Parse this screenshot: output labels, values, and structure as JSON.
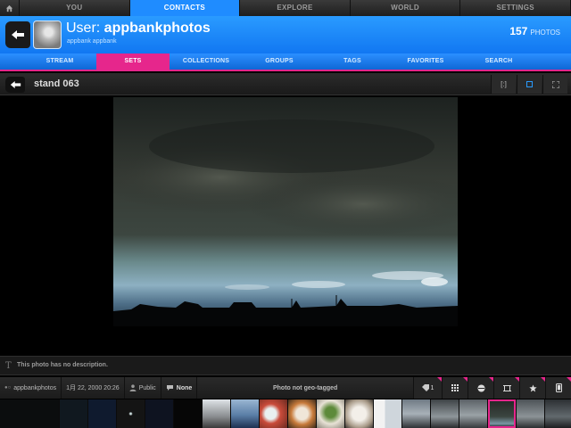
{
  "topnav": {
    "tabs": [
      {
        "label": "YOU"
      },
      {
        "label": "CONTACTS"
      },
      {
        "label": "EXPLORE"
      },
      {
        "label": "WORLD"
      },
      {
        "label": "SETTINGS"
      }
    ],
    "active": 1
  },
  "header": {
    "title_prefix": "User: ",
    "username": "appbankphotos",
    "subtitle": "appbank appbank",
    "photo_count": "157",
    "photo_count_label": "PHOTOS"
  },
  "subtabs": {
    "items": [
      {
        "label": "STREAM"
      },
      {
        "label": "SETS"
      },
      {
        "label": "COLLECTIONS"
      },
      {
        "label": "GROUPS"
      },
      {
        "label": "TAGS"
      },
      {
        "label": "FAVORITES"
      },
      {
        "label": "SEARCH"
      }
    ],
    "active": 1
  },
  "photo_view": {
    "set_title": "stand 063",
    "view_buttons": [
      {
        "glyph": "[:]"
      },
      {
        "glyph": "□"
      },
      {
        "glyph": "⛶"
      }
    ]
  },
  "description": {
    "icon": "text-icon",
    "text": "This photo has no description."
  },
  "info": {
    "owner": "appbankphotos",
    "date": "1月 22, 2000 20:26",
    "privacy": "Public",
    "comments": "None",
    "geo": "Photo not geo-tagged",
    "tag_count": "1"
  },
  "colors": {
    "accent_blue": "#1f8cff",
    "accent_pink": "#e6268c"
  }
}
